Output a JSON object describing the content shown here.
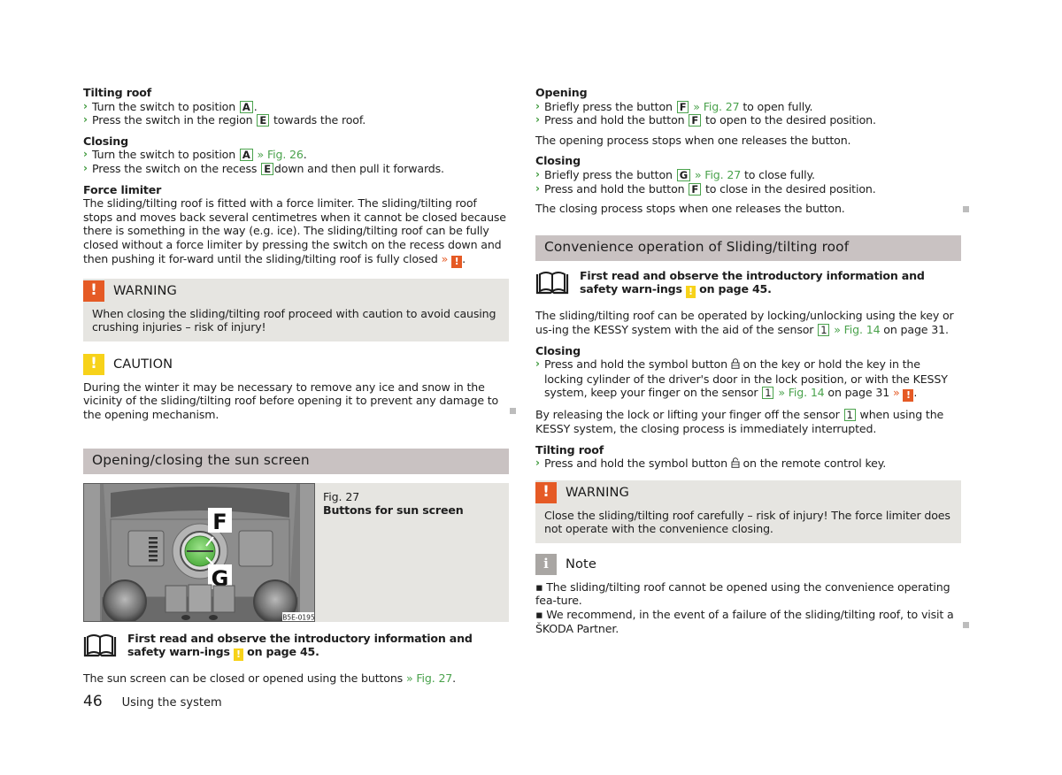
{
  "left": {
    "tilting_roof": {
      "title": "Tilting roof",
      "steps": [
        {
          "pre": "Turn the switch to position",
          "key": "A",
          "post": "."
        },
        {
          "pre": "Press the switch in the region",
          "key": "E",
          "post": "towards the roof."
        }
      ]
    },
    "closing": {
      "title": "Closing",
      "steps": [
        {
          "pre": "Turn the switch to position",
          "key": "A",
          "ref": "» Fig. 26",
          "post": "."
        },
        {
          "pre": "Press the switch on the recess",
          "key": "E",
          "post": "down and then pull it forwards."
        }
      ]
    },
    "force_limiter": {
      "title": "Force limiter",
      "text": "The sliding/tilting roof is fitted with a force limiter. The sliding/tilting roof stops and moves back several centimetres when it cannot be closed because there is something in the way (e.g. ice). The sliding/tilting roof can be fully closed without a force limiter by pressing the switch on the recess down and then pushing it for-ward until the sliding/tilting roof is fully closed",
      "ref": "»",
      "warn_glyph": "!",
      "post": "."
    },
    "warning": {
      "icon": "!",
      "title": "WARNING",
      "text": "When closing the sliding/tilting roof proceed with caution to avoid causing crushing injuries – risk of injury!"
    },
    "caution": {
      "icon": "!",
      "title": "CAUTION",
      "text": "During the winter it may be necessary to remove any ice and snow in the vicinity of the sliding/tilting roof before opening it to prevent any damage to the opening mechanism."
    },
    "sun_screen": {
      "heading": "Opening/closing the sun screen",
      "figure": {
        "number": "Fig. 27",
        "caption": "Buttons for sun screen",
        "label_f": "F",
        "label_g": "G",
        "code": "B5E-0195"
      },
      "read_first": {
        "pre": "First read and observe the introductory information and safety warn-ings",
        "glyph": "!",
        "post": "on page 45."
      },
      "text_pre": "The sun screen can be closed or opened using the buttons",
      "text_ref": "» Fig. 27",
      "text_post": "."
    }
  },
  "right": {
    "opening": {
      "title": "Opening",
      "steps": [
        {
          "pre": "Briefly press the button",
          "key": "F",
          "ref": "» Fig. 27",
          "post": "to open fully."
        },
        {
          "pre": "Press and hold the button",
          "key": "F",
          "post": "to open to the desired position."
        }
      ],
      "note": "The opening process stops when one releases the button."
    },
    "closing": {
      "title": "Closing",
      "steps": [
        {
          "pre": "Briefly press the button",
          "key": "G",
          "ref": "» Fig. 27",
          "post": "to close fully."
        },
        {
          "pre": "Press and hold the button",
          "key": "F",
          "post": "to close in the desired position."
        }
      ],
      "note": "The closing process stops when one releases the button."
    },
    "convenience": {
      "heading": "Convenience operation of Sliding/tilting roof",
      "read_first": {
        "pre": "First read and observe the introductory information and safety warn-ings",
        "glyph": "!",
        "post": "on page 45."
      },
      "intro_pre": "The sliding/tilting roof can be operated by locking/unlocking using the key or us-ing the KESSY system with the aid of the sensor",
      "intro_key": "1",
      "intro_ref": "» Fig. 14",
      "intro_post": "on page 31.",
      "closing": {
        "title": "Closing",
        "step_pre": "Press and hold the symbol button",
        "step_symbol": "lock-closed",
        "step_mid": "on the key or hold the key in the locking cylinder of the driver's door in the lock position, or with the KESSY system, keep your finger on the sensor",
        "step_key": "1",
        "step_ref": "» Fig. 14",
        "step_post": "on page 31",
        "step_warn_ref": "»",
        "step_glyph": "!",
        "step_end": "."
      },
      "release_pre": "By releasing the lock or lifting your finger off the sensor",
      "release_key": "1",
      "release_post": "when using the KESSY system, the closing process is immediately interrupted.",
      "tilting": {
        "title": "Tilting roof",
        "step_pre": "Press and hold the symbol button",
        "step_symbol": "lock-open",
        "step_post": "on the remote control key."
      }
    },
    "warning": {
      "icon": "!",
      "title": "WARNING",
      "text": "Close the sliding/tilting roof carefully – risk of injury! The force limiter does not operate with the convenience closing."
    },
    "note": {
      "icon": "i",
      "title": "Note",
      "bullets": [
        "The sliding/tilting roof cannot be opened using the convenience operating fea-ture.",
        "We recommend, in the event of a failure of the sliding/tilting roof, to visit a ŠKODA Partner."
      ]
    }
  },
  "footer": {
    "page_number": "46",
    "section": "Using the system"
  },
  "colors": {
    "accent_green": "#4aa24c",
    "warning_orange": "#e55a25",
    "caution_yellow": "#f7d21a",
    "note_gray": "#a9a6a3",
    "section_bar": "#c9c2c2",
    "box_bg": "#e6e5e1"
  }
}
